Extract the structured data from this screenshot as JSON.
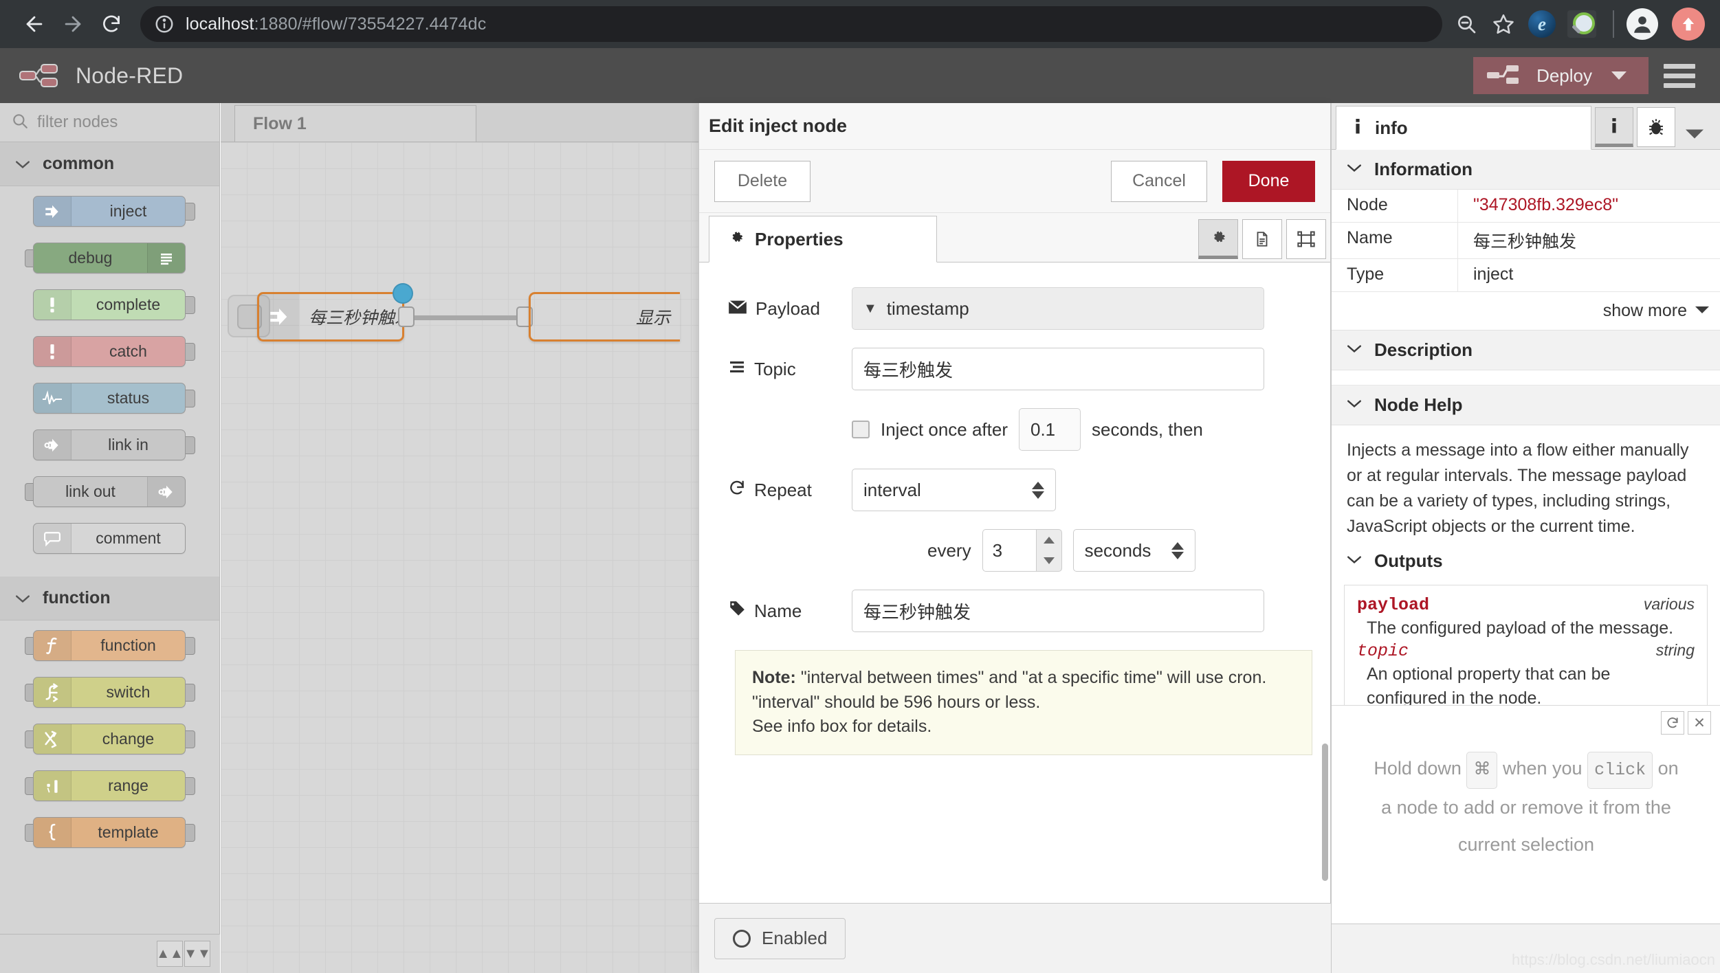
{
  "browser": {
    "url_host": "localhost",
    "url_rest": ":1880/#flow/73554227.4474dc",
    "back_icon": "back-arrow-icon",
    "forward_icon": "forward-arrow-icon",
    "reload_icon": "reload-icon",
    "info_icon": "site-info-icon",
    "zoom_icon": "zoom-out-icon",
    "bookmark_icon": "star-icon",
    "extension_e_icon": "extension-e-icon",
    "extension_mag_icon": "extension-magnifier-icon",
    "profile_icon": "profile-avatar-icon",
    "update_icon": "update-arrow-icon"
  },
  "header": {
    "title": "Node-RED",
    "deploy_label": "Deploy",
    "logo_icon": "node-red-logo-icon",
    "deploy_icon": "deploy-node-icon",
    "menu_icon": "hamburger-menu-icon"
  },
  "palette": {
    "search_placeholder": "filter nodes",
    "search_icon": "search-icon",
    "categories": [
      {
        "name": "common",
        "nodes": [
          {
            "label": "inject",
            "icon": "inject-arrow-icon",
            "bg": "#a6bbcf",
            "align": "icon-left",
            "ports": [
              "out"
            ]
          },
          {
            "label": "debug",
            "icon": "debug-lines-icon",
            "bg": "#87a980",
            "align": "icon-right",
            "ports": [
              "in"
            ]
          },
          {
            "label": "complete",
            "icon": "bang-icon",
            "bg": "#c0dcb4",
            "align": "icon-left",
            "ports": [
              "out"
            ]
          },
          {
            "label": "catch",
            "icon": "bang-icon",
            "bg": "#d8a3a3",
            "align": "icon-left",
            "ports": [
              "out"
            ]
          },
          {
            "label": "status",
            "icon": "pulse-icon",
            "bg": "#a5bfcc",
            "align": "icon-left",
            "ports": [
              "out"
            ]
          },
          {
            "label": "link in",
            "icon": "link-arrow-icon",
            "bg": "#c7c7c7",
            "align": "icon-left",
            "ports": [
              "out"
            ]
          },
          {
            "label": "link out",
            "icon": "link-arrow-icon",
            "bg": "#c7c7c7",
            "align": "icon-right",
            "ports": [
              "in"
            ]
          },
          {
            "label": "comment",
            "icon": "speech-bubble-icon",
            "bg": "#d6d6d6",
            "align": "icon-left",
            "ports": []
          }
        ]
      },
      {
        "name": "function",
        "nodes": [
          {
            "label": "function",
            "icon": "f-italic-icon",
            "bg": "#e2b68d",
            "align": "icon-left",
            "ports": [
              "in",
              "out"
            ]
          },
          {
            "label": "switch",
            "icon": "switch-branch-icon",
            "bg": "#cfd08a",
            "align": "icon-left",
            "ports": [
              "in",
              "out"
            ]
          },
          {
            "label": "change",
            "icon": "change-cross-icon",
            "bg": "#cfd08a",
            "align": "icon-left",
            "ports": [
              "in",
              "out"
            ]
          },
          {
            "label": "range",
            "icon": "range-bars-icon",
            "bg": "#cfd08a",
            "align": "icon-left",
            "ports": [
              "in",
              "out"
            ]
          },
          {
            "label": "template",
            "icon": "brace-icon",
            "bg": "#dfb184",
            "align": "icon-left",
            "ports": [
              "in",
              "out"
            ]
          }
        ]
      }
    ],
    "footer_collapse_icon": "collapse-all-icon",
    "footer_expand_icon": "expand-all-icon"
  },
  "canvas": {
    "tab_label": "Flow 1",
    "nodes": [
      {
        "label": "每三秒钟触发 ↻",
        "bg": "#a6bbcf",
        "icon": "inject-arrow-icon"
      },
      {
        "label": "显示",
        "bg": "#a3bf9b",
        "icon": "debug-lines-icon"
      }
    ]
  },
  "dialog": {
    "title": "Edit inject node",
    "delete_label": "Delete",
    "cancel_label": "Cancel",
    "done_label": "Done",
    "tab_properties_label": "Properties",
    "tab_properties_icon": "gear-icon",
    "tab_buttons": [
      {
        "icon": "gear-icon",
        "active": true
      },
      {
        "icon": "document-icon",
        "active": false
      },
      {
        "icon": "appearance-icon",
        "active": false
      }
    ],
    "fields": {
      "payload_label": "Payload",
      "payload_icon": "envelope-icon",
      "payload_value": "timestamp",
      "topic_label": "Topic",
      "topic_icon": "list-icon",
      "topic_value": "每三秒触发",
      "inject_once_label": "Inject once after",
      "inject_once_seconds": "0.1",
      "inject_once_suffix": "seconds, then",
      "inject_once_checked": false,
      "repeat_label": "Repeat",
      "repeat_icon": "repeat-icon",
      "repeat_value": "interval",
      "every_label": "every",
      "every_value": "3",
      "every_unit": "seconds",
      "name_label": "Name",
      "name_icon": "tag-icon",
      "name_value": "每三秒钟触发"
    },
    "note": {
      "prefix": "Note:",
      "line1": " \"interval between times\" and \"at a specific time\" will use cron.",
      "line2": "\"interval\" should be 596 hours or less.",
      "line3": "See info box for details."
    },
    "enabled_label": "Enabled",
    "enabled_icon": "toggle-circle-icon"
  },
  "sidebar": {
    "tab_label": "info",
    "tab_icon": "info-icon",
    "buttons": [
      {
        "icon": "info-icon",
        "active": true
      },
      {
        "icon": "bug-icon",
        "active": false
      }
    ],
    "caret_icon": "chevron-down-icon",
    "information_title": "Information",
    "information_rows": [
      {
        "key": "Node",
        "value": "\"347308fb.329ec8\"",
        "is_id": true
      },
      {
        "key": "Name",
        "value": "每三秒钟触发",
        "is_id": false
      },
      {
        "key": "Type",
        "value": "inject",
        "is_id": false
      }
    ],
    "show_more_label": "show more",
    "description_title": "Description",
    "node_help_title": "Node Help",
    "node_help_body": "Injects a message into a flow either manually or at regular intervals. The message payload can be a variety of types, including strings, JavaScript objects or the current time.",
    "outputs_title": "Outputs",
    "outputs": [
      {
        "name": "payload",
        "type": "various",
        "desc": "The configured payload of the message.",
        "italic": false
      },
      {
        "name": "topic",
        "type": "string",
        "desc": "An optional property that can be configured in the node.",
        "italic": true
      }
    ],
    "hint": {
      "part1": "Hold down",
      "key1": "⌘",
      "part2": "when you",
      "key2": "click",
      "part3": "on",
      "line2": "a node to add or remove it from the",
      "line3": "current selection",
      "refresh_icon": "refresh-icon",
      "close_icon": "close-icon"
    },
    "watermark": "https://blog.csdn.net/liumiaocn"
  }
}
